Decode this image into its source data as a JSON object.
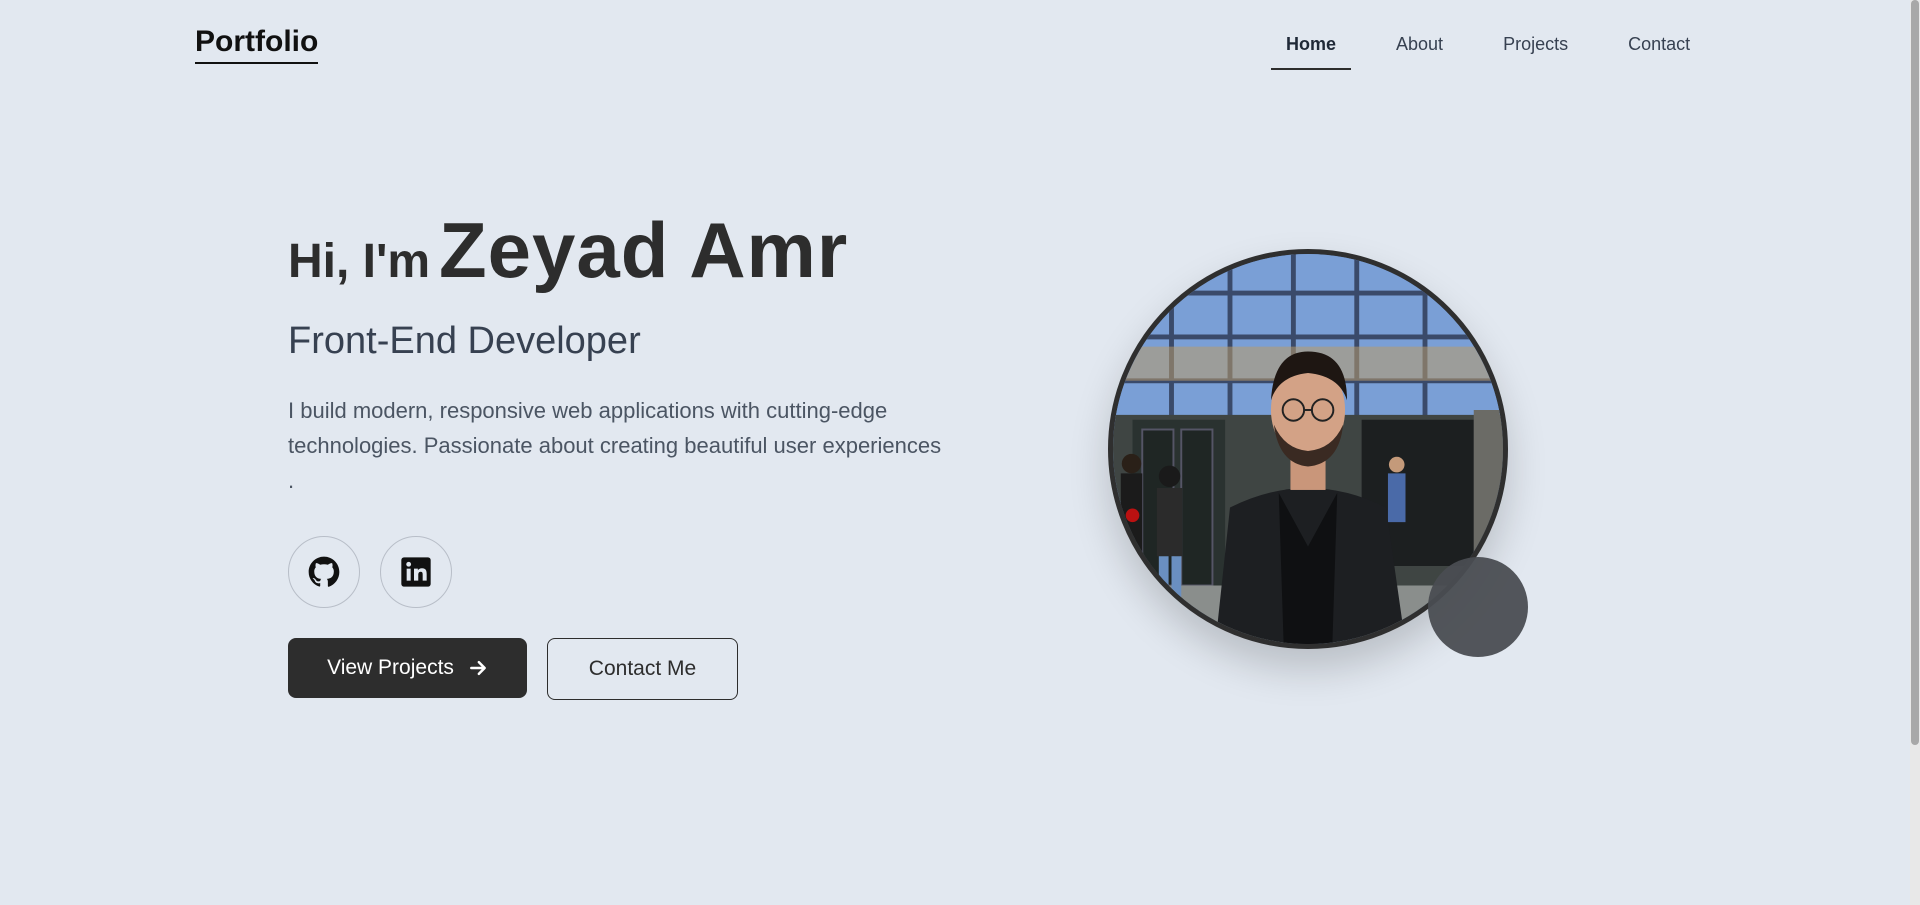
{
  "nav": {
    "logo": "Portfolio",
    "links": [
      {
        "label": "Home",
        "active": true
      },
      {
        "label": "About",
        "active": false
      },
      {
        "label": "Projects",
        "active": false
      },
      {
        "label": "Contact",
        "active": false
      }
    ]
  },
  "hero": {
    "greeting_prefix": "Hi, I'm",
    "name": "Zeyad Amr",
    "role": "Front-End Developer",
    "description": "I build modern, responsive web applications with cutting-edge technologies. Passionate about creating beautiful user experiences .",
    "socials": [
      {
        "icon": "github-icon"
      },
      {
        "icon": "linkedin-icon"
      }
    ],
    "primary_button": "View Projects",
    "secondary_button": "Contact Me"
  },
  "colors": {
    "background": "#e2e8f0",
    "primary": "#2d2d2d",
    "accent_blob": "#4a4d52"
  }
}
